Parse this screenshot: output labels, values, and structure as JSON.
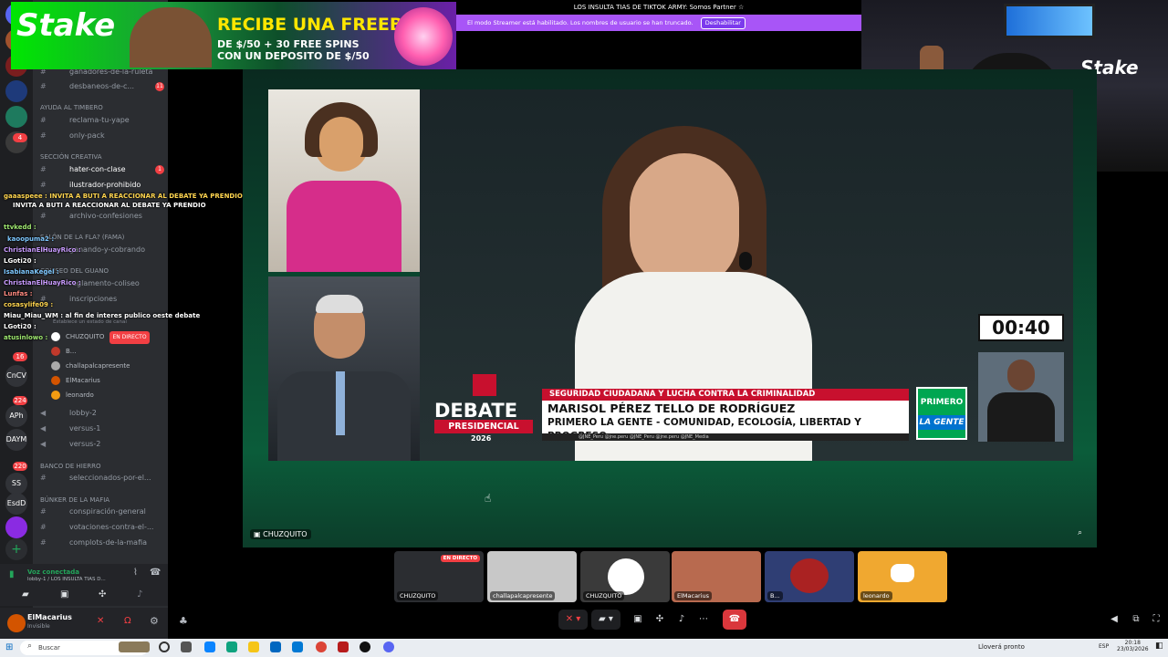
{
  "sidebar": {
    "channels": [
      {
        "label": "ganadores-de-la-ruleta"
      },
      {
        "label": "desbaneos-de-c...",
        "badge": "11"
      },
      {
        "label": "reclama-tu-yape"
      },
      {
        "label": "only-pack"
      },
      {
        "label": "hater-con-clase",
        "badge": "1"
      },
      {
        "label": "ilustrador-prohibido"
      },
      {
        "label": "archivo-confesiones"
      },
      {
        "label": "ganando-y-cobrando"
      },
      {
        "label": "reglamento-coliseo"
      },
      {
        "label": "inscripciones"
      },
      {
        "label": "lobby-2"
      },
      {
        "label": "versus-1"
      },
      {
        "label": "versus-2"
      },
      {
        "label": "seleccionados-por-el..."
      },
      {
        "label": "conspiración-general"
      },
      {
        "label": "votaciones-contra-el-..."
      },
      {
        "label": "complots-de-la-mafia"
      }
    ],
    "categories": {
      "ayuda": "AYUDA AL TIMBERO",
      "creativa": "SECCIÓN CREATIVA",
      "fama": "SALÓN DE LA FLA? (FAMA)",
      "coliseo": "COLISEO DEL GUANO",
      "banco": "BANCO DE HIERRO",
      "bunker": "BÚNKER DE LA MAFIA"
    },
    "voice_status_placeholder": "Establece un estado de canal",
    "voice_users": [
      "CHUZQUITO",
      "B...",
      "challapalcapresente",
      "ElMacarius",
      "leonardo"
    ],
    "live_label": "EN DIRECTO"
  },
  "rail": {
    "items": [
      "",
      "",
      "",
      "",
      "",
      "",
      "",
      "CnCV",
      "APh",
      "DAYM",
      "SS",
      "EsdD"
    ],
    "badges": [
      "4",
      "1",
      "7",
      "16",
      "224",
      "220"
    ]
  },
  "chat": [
    "gaaaspeee : INVITA A BUTI A REACCIONAR AL DEBATE YA PRENDIO",
    "INVITA A BUTI A REACCIONAR AL DEBATE YA PRENDIO",
    "ttvkedd :",
    "kaoopuma2 :",
    "ChristianElHuayRico :",
    "LGoti20 :",
    "IsabianaKegel :",
    "ChristianElHuayRico :",
    "Lunfas :",
    "cosasylife09 :",
    "Miau_Miau_WM : al fin de interes publico oeste debate",
    "LGoti20 :",
    "atusinlowo :"
  ],
  "voice_panel": {
    "status": "Voz conectada",
    "channel": "lobby-1 / LOS INSULTA TIAS D..."
  },
  "user": {
    "name": "ElMacarius",
    "status": "Invisible"
  },
  "ad": {
    "logo": "Stake",
    "headline": "RECIBE UNA FREEBET",
    "subline1": "DE $/50 + 30 FREE SPINS",
    "subline2": "CON UN DEPOSITO DE $/50"
  },
  "topbar": {
    "title": "LOS INSULTA TIAS DE TIKTOK ARMY: Somos Partner ☆",
    "streamer_notice": "El modo Streamer está habilitado. Los nombres de usuario se han truncado.",
    "streamer_button": "Deshabilitar"
  },
  "webcam": {
    "logo": "Stake"
  },
  "stream": {
    "timer": "00:40",
    "lower_third_topic": "SEGURIDAD CIUDADANA Y LUCHA CONTRA LA CRIMINALIDAD",
    "lower_third_name": "MARISOL PÉREZ TELLO DE RODRÍGUEZ",
    "lower_third_party": "PRIMERO LA GENTE - COMUNIDAD, ECOLOGÍA, LIBERTAD Y PROGRESO",
    "lower_third_footer": "@JNE_Peru   @jne.peru   @JNE_Peru   @jne.peru   @JNE_Media",
    "debate_word": "DEBATE",
    "debate_presidencial": "PRESIDENCIAL",
    "debate_year": "2026",
    "party_line1": "PRIMERO",
    "party_line2": "LA GENTE",
    "owner": "CHUZQUITO"
  },
  "tiles": [
    {
      "name": "CHUZQUITO",
      "live": "EN DIRECTO",
      "color": "#2b2d31"
    },
    {
      "name": "challapalcapresente",
      "color": "#c8c8c8"
    },
    {
      "name": "CHUZQUITO",
      "color": "#3a3a3a"
    },
    {
      "name": "ElMacarius",
      "color": "#b86a4f"
    },
    {
      "name": "B...",
      "color": "#2f3e74"
    },
    {
      "name": "leonardo",
      "color": "#f0a830"
    }
  ],
  "taskbar": {
    "search_placeholder": "Buscar",
    "weather": "Lloverá pronto",
    "time": "20:18",
    "date": "23/03/2026",
    "lang": "ESP"
  },
  "colors": {
    "accent": "#5865f2",
    "live": "#f23f43",
    "streamer_bar": "#a855f7",
    "stake_green": "#00e701"
  }
}
